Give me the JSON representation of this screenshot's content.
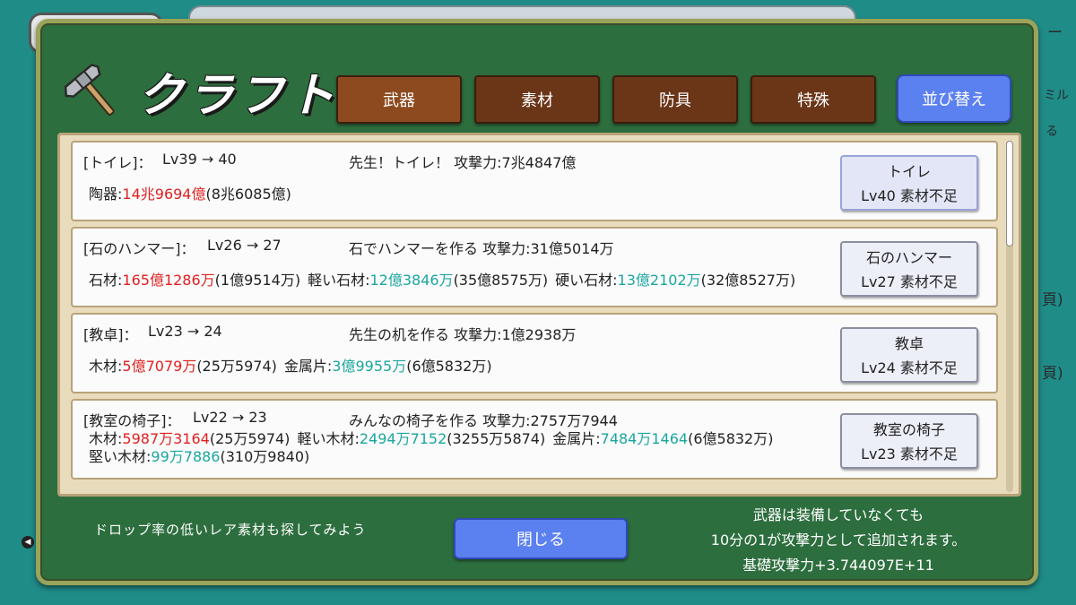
{
  "title": "クラフト",
  "tabs": [
    {
      "label": "武器",
      "active": true
    },
    {
      "label": "素材",
      "active": false
    },
    {
      "label": "防具",
      "active": false
    },
    {
      "label": "特殊",
      "active": false
    }
  ],
  "sort_button": "並び替え",
  "recipes": [
    {
      "name": "[トイレ]：",
      "level": "Lv39 → 40",
      "description": "先生！トイレ！ 攻撃力:7兆4847億",
      "materials_line1": [
        {
          "label": "陶器:",
          "need": "14兆9694億",
          "need_color": "red",
          "have": "(8兆6085億)"
        }
      ],
      "materials_line2": [],
      "button_name": "トイレ",
      "button_status": "Lv40 素材不足"
    },
    {
      "name": "[石のハンマー]：",
      "level": "Lv26 → 27",
      "description": "石でハンマーを作る 攻撃力:31億5014万",
      "materials_line1": [
        {
          "label": "石材:",
          "need": "165億1286万",
          "need_color": "red",
          "have": "(1億9514万)"
        },
        {
          "label": "軽い石材:",
          "need": "12億3846万",
          "need_color": "teal",
          "have": "(35億8575万)"
        },
        {
          "label": "硬い石材:",
          "need": "13億2102万",
          "need_color": "teal",
          "have": "(32億8527万)"
        }
      ],
      "materials_line2": [],
      "button_name": "石のハンマー",
      "button_status": "Lv27 素材不足"
    },
    {
      "name": "[教卓]：",
      "level": "Lv23 → 24",
      "description": "先生の机を作る 攻撃力:1億2938万",
      "materials_line1": [
        {
          "label": "木材:",
          "need": "5億7079万",
          "need_color": "red",
          "have": "(25万5974)"
        },
        {
          "label": "金属片:",
          "need": "3億9955万",
          "need_color": "teal",
          "have": "(6億5832万)"
        }
      ],
      "materials_line2": [],
      "button_name": "教卓",
      "button_status": "Lv24 素材不足"
    },
    {
      "name": "[教室の椅子]：",
      "level": "Lv22 → 23",
      "description": "みんなの椅子を作る 攻撃力:2757万7944",
      "materials_line1": [
        {
          "label": "木材:",
          "need": "5987万3164",
          "need_color": "red",
          "have": "(25万5974)"
        },
        {
          "label": "軽い木材:",
          "need": "2494万7152",
          "need_color": "teal",
          "have": "(3255万5874)"
        },
        {
          "label": "金属片:",
          "need": "7484万1464",
          "need_color": "teal",
          "have": "(6億5832万)"
        }
      ],
      "materials_line2": [
        {
          "label": "堅い木材:",
          "need": "99万7886",
          "need_color": "teal",
          "have": "(310万9840)"
        }
      ],
      "button_name": "教室の椅子",
      "button_status": "Lv23 素材不足"
    }
  ],
  "hint_text": "ドロップ率の低いレア素材も探してみよう",
  "close_button": "閉じる",
  "info_lines": [
    "武器は装備していなくても",
    "10分の1が攻撃力として追加されます。",
    "基礎攻撃力+3.744097E+11"
  ],
  "background_fragments": [
    "ー",
    "ミル",
    "る",
    "頁)",
    "頁)"
  ]
}
